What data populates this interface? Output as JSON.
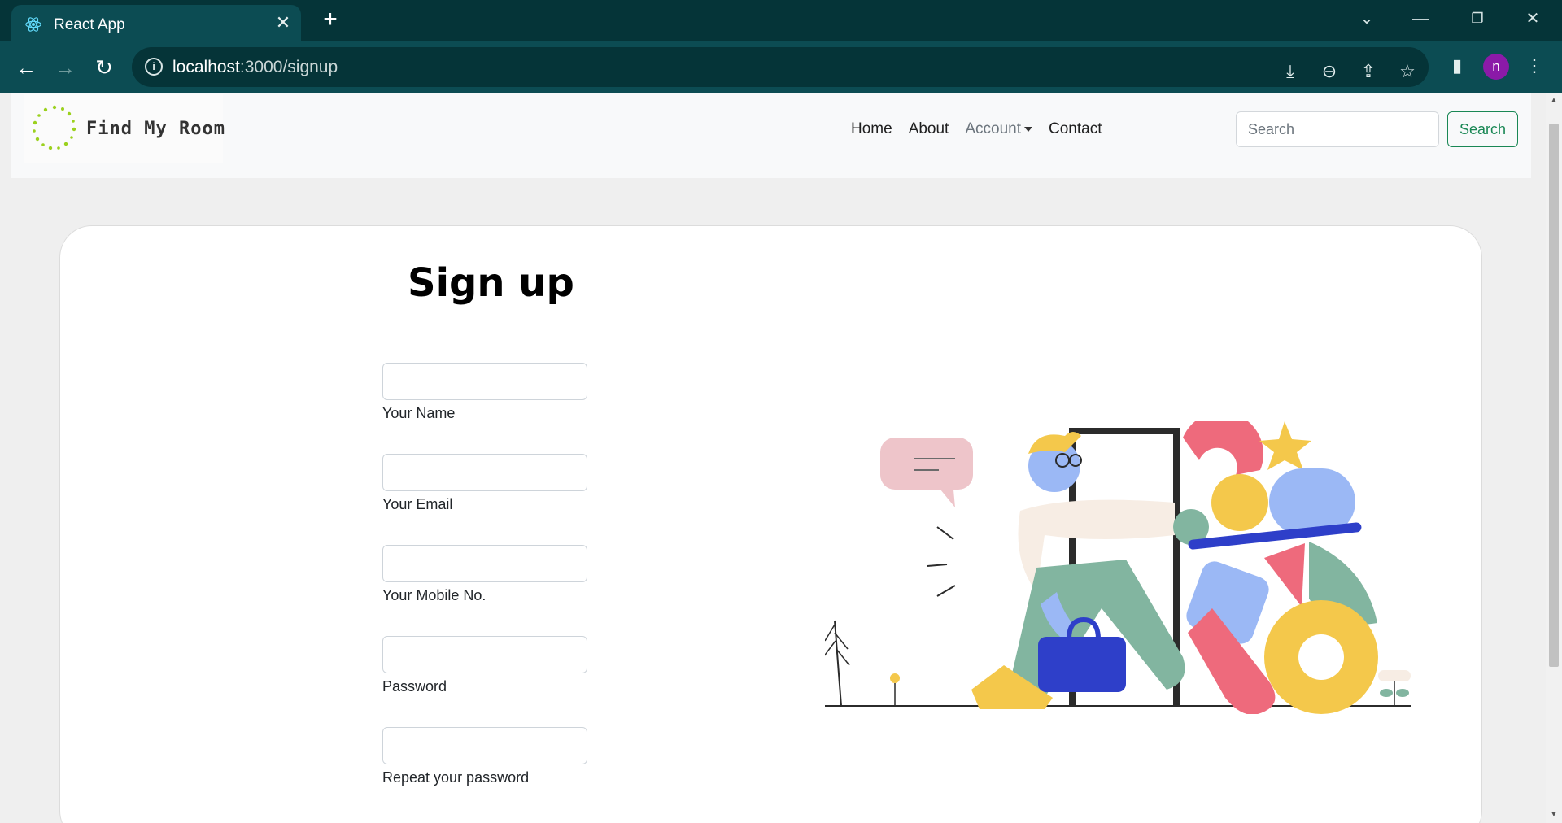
{
  "browser": {
    "tab_title": "React App",
    "url_host": "localhost",
    "url_path": ":3000/signup",
    "profile_initial": "n"
  },
  "navbar": {
    "brand": "Find My Room",
    "links": [
      {
        "label": "Home"
      },
      {
        "label": "About"
      },
      {
        "label": "Account"
      },
      {
        "label": "Contact"
      }
    ],
    "search_placeholder": "Search",
    "search_button": "Search"
  },
  "signup": {
    "title": "Sign up",
    "fields": [
      {
        "label": "Your Name"
      },
      {
        "label": "Your Email"
      },
      {
        "label": "Your Mobile No."
      },
      {
        "label": "Password"
      },
      {
        "label": "Repeat your password"
      }
    ]
  },
  "colors": {
    "chrome_dark": "#053438",
    "chrome_toolbar": "#0c4c53",
    "success": "#198754",
    "profile": "#8b1aa8"
  }
}
